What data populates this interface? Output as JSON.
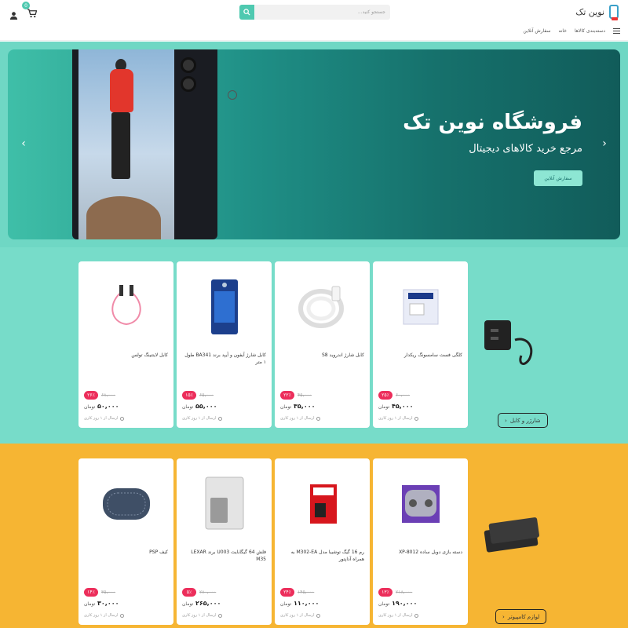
{
  "header": {
    "logo_text": "نوین تک",
    "search_placeholder": "جستجو کنید...",
    "cart_count": "0",
    "icons": {
      "search": "search-icon",
      "user": "user-icon",
      "cart": "cart-icon",
      "logo": "phone-logo-icon"
    }
  },
  "nav": {
    "categories_label": "دسته‌بندی کالاها",
    "home_label": "خانه",
    "online_order_label": "سفارش آنلاین"
  },
  "hero": {
    "title": "فروشگاه نوین تک",
    "subtitle": "مرجع خرید کالاهای دیجیتال",
    "button_label": "سفارش آنلاین"
  },
  "section1": {
    "category_button": "شارژر و کابل",
    "products": [
      {
        "name": "کابل لایتنینگ تولس",
        "discount": "۲۶٪",
        "old_price": "۶۸,۰۰۰",
        "price": "۵۰,۰۰۰",
        "currency": "تومان",
        "ship": "ارسال از ۱ روز کاری"
      },
      {
        "name": "کابل شارژ آیفون و آیپد برند BA341 طول ۱ متر",
        "discount": "۱۵٪",
        "old_price": "۶۵,۰۰۰",
        "price": "۵۵,۰۰۰",
        "currency": "تومان",
        "ship": "ارسال از ۱ روز کاری"
      },
      {
        "name": "کابل شارژ اندروید S8",
        "discount": "۲۲٪",
        "old_price": "۴۵,۰۰۰",
        "price": "۳۵,۰۰۰",
        "currency": "تومان",
        "ship": "ارسال از ۱ روز کاری"
      },
      {
        "name": "کلگی فست سامسونگ ریکدار",
        "discount": "۲۵٪",
        "old_price": "۶۰,۰۰۰",
        "price": "۴۵,۰۰۰",
        "currency": "تومان",
        "ship": "ارسال از ۱ روز کاری"
      }
    ]
  },
  "section2": {
    "category_button": "لوازم کامپیوتر",
    "products": [
      {
        "name": "کیف PSP",
        "discount": "۱۴٪",
        "old_price": "۳۵,۰۰۰",
        "price": "۳۰,۰۰۰",
        "currency": "تومان",
        "ship": "ارسال از ۱ روز کاری"
      },
      {
        "name": "فلش 64 گیگابایت U003 برند LEXAR M35",
        "discount": "۵٪",
        "old_price": "۲۸۰,۰۰۰",
        "price": "۲۶۵,۰۰۰",
        "currency": "تومان",
        "ship": "ارسال از ۱ روز کاری"
      },
      {
        "name": "رم 16 گیگ توشیبا مدل M302-EA به همراه آداپتور",
        "discount": "۲۴٪",
        "old_price": "۱۴۵,۰۰۰",
        "price": "۱۱۰,۰۰۰",
        "currency": "تومان",
        "ship": "ارسال از ۱ روز کاری"
      },
      {
        "name": "دسته بازی دوبل ساده XP-8012",
        "discount": "۱۳٪",
        "old_price": "۲۱۸,۰۰۰",
        "price": "۱۹۰,۰۰۰",
        "currency": "تومان",
        "ship": "ارسال از ۱ روز کاری"
      }
    ]
  },
  "colors": {
    "accent": "#4fc9b0",
    "section1_bg": "#77dcc9",
    "section2_bg": "#f6b533",
    "discount": "#ec2e5b"
  }
}
